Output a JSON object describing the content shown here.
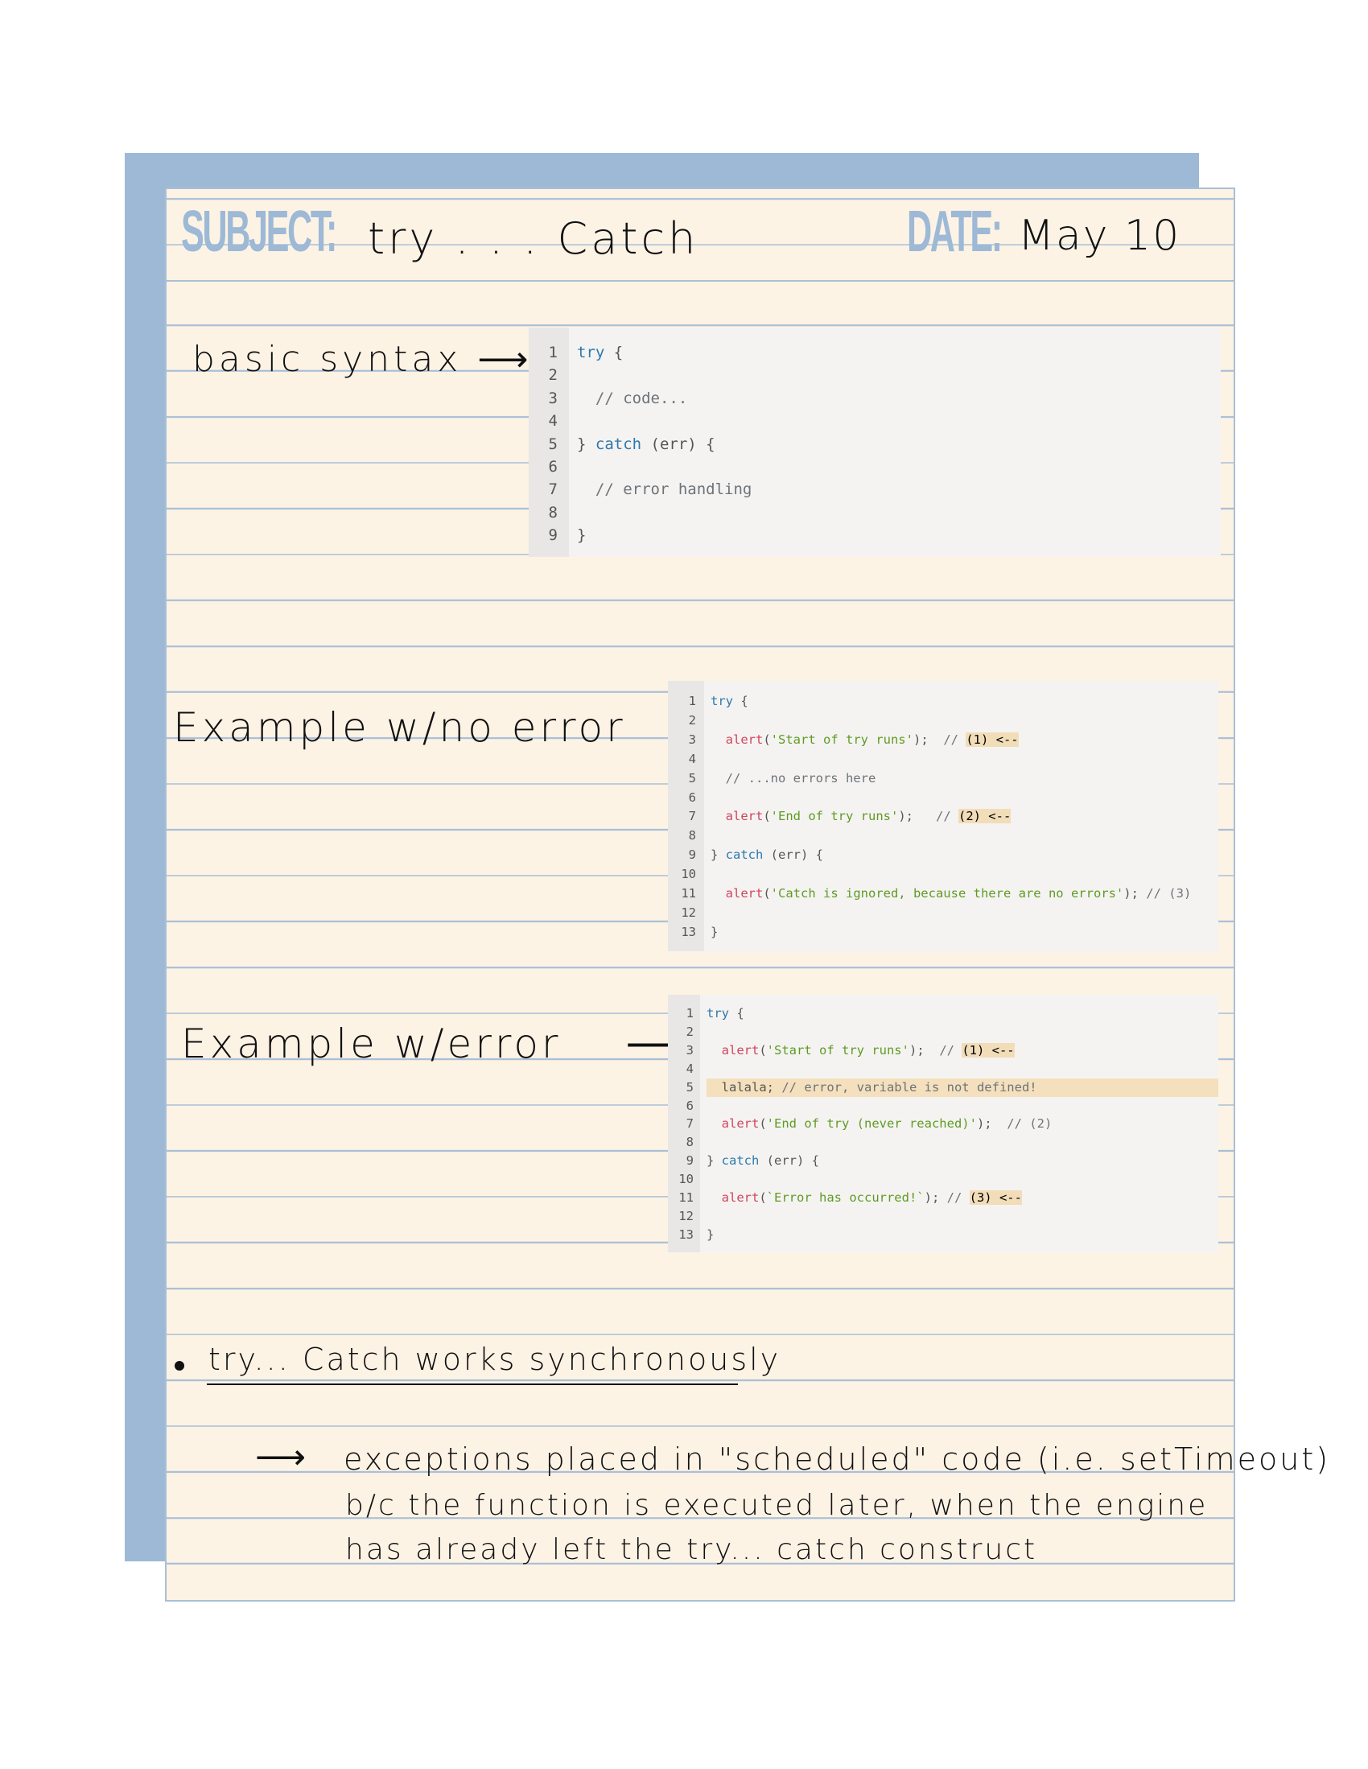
{
  "header": {
    "subject_label": "SUBJECT:",
    "subject_value": "try . . . Catch",
    "date_label": "DATE:",
    "date_value": "May 10"
  },
  "sections": {
    "basic": {
      "label": "basic syntax",
      "arrow": "⟶"
    },
    "no_error": {
      "label": "Example w/no error",
      "arrow": "⟶"
    },
    "with_error": {
      "label": "Example w/error",
      "arrow": "⟶"
    }
  },
  "code_basic": [
    {
      "n": "1",
      "parts": [
        [
          "kw",
          "try"
        ],
        [
          "pn",
          " {"
        ]
      ]
    },
    {
      "n": "2",
      "parts": []
    },
    {
      "n": "3",
      "parts": [
        [
          "cm",
          "  // code..."
        ]
      ]
    },
    {
      "n": "4",
      "parts": []
    },
    {
      "n": "5",
      "parts": [
        [
          "pn",
          "} "
        ],
        [
          "kw",
          "catch"
        ],
        [
          "pn",
          " (err) {"
        ]
      ]
    },
    {
      "n": "6",
      "parts": []
    },
    {
      "n": "7",
      "parts": [
        [
          "cm",
          "  // error handling"
        ]
      ]
    },
    {
      "n": "8",
      "parts": []
    },
    {
      "n": "9",
      "parts": [
        [
          "pn",
          "}"
        ]
      ]
    }
  ],
  "code_no_error": [
    {
      "n": "1",
      "parts": [
        [
          "kw",
          "try"
        ],
        [
          "pn",
          " {"
        ]
      ]
    },
    {
      "n": "2",
      "parts": []
    },
    {
      "n": "3",
      "parts": [
        [
          "fn",
          "  alert"
        ],
        [
          "pn",
          "("
        ],
        [
          "str",
          "'Start of try runs'"
        ],
        [
          "pn",
          ");  "
        ],
        [
          "cm",
          "// "
        ],
        [
          "hl",
          "(1) <--"
        ]
      ]
    },
    {
      "n": "4",
      "parts": []
    },
    {
      "n": "5",
      "parts": [
        [
          "cm",
          "  // ...no errors here"
        ]
      ]
    },
    {
      "n": "6",
      "parts": []
    },
    {
      "n": "7",
      "parts": [
        [
          "fn",
          "  alert"
        ],
        [
          "pn",
          "("
        ],
        [
          "str",
          "'End of try runs'"
        ],
        [
          "pn",
          ");   "
        ],
        [
          "cm",
          "// "
        ],
        [
          "hl",
          "(2) <--"
        ]
      ]
    },
    {
      "n": "8",
      "parts": []
    },
    {
      "n": "9",
      "parts": [
        [
          "pn",
          "} "
        ],
        [
          "kw",
          "catch"
        ],
        [
          "pn",
          " (err) {"
        ]
      ]
    },
    {
      "n": "10",
      "parts": []
    },
    {
      "n": "11",
      "parts": [
        [
          "fn",
          "  alert"
        ],
        [
          "pn",
          "("
        ],
        [
          "str",
          "'Catch is ignored, because there are no errors'"
        ],
        [
          "pn",
          "); "
        ],
        [
          "cm",
          "// (3)"
        ]
      ]
    },
    {
      "n": "12",
      "parts": []
    },
    {
      "n": "13",
      "parts": [
        [
          "pn",
          "}"
        ]
      ]
    }
  ],
  "code_with_error": [
    {
      "n": "1",
      "parts": [
        [
          "kw",
          "try"
        ],
        [
          "pn",
          " {"
        ]
      ]
    },
    {
      "n": "2",
      "parts": []
    },
    {
      "n": "3",
      "parts": [
        [
          "fn",
          "  alert"
        ],
        [
          "pn",
          "("
        ],
        [
          "str",
          "'Start of try runs'"
        ],
        [
          "pn",
          ");  "
        ],
        [
          "cm",
          "// "
        ],
        [
          "hl",
          "(1) <--"
        ]
      ]
    },
    {
      "n": "4",
      "parts": []
    },
    {
      "n": "5",
      "row_hl": true,
      "parts": [
        [
          "pn",
          "  lalala; "
        ],
        [
          "cm",
          "// error, variable is not defined!"
        ]
      ]
    },
    {
      "n": "6",
      "parts": []
    },
    {
      "n": "7",
      "parts": [
        [
          "fn",
          "  alert"
        ],
        [
          "pn",
          "("
        ],
        [
          "str",
          "'End of try (never reached)'"
        ],
        [
          "pn",
          ");  "
        ],
        [
          "cm",
          "// (2)"
        ]
      ]
    },
    {
      "n": "8",
      "parts": []
    },
    {
      "n": "9",
      "parts": [
        [
          "pn",
          "} "
        ],
        [
          "kw",
          "catch"
        ],
        [
          "pn",
          " (err) {"
        ]
      ]
    },
    {
      "n": "10",
      "parts": []
    },
    {
      "n": "11",
      "parts": [
        [
          "fn",
          "  alert"
        ],
        [
          "pn",
          "("
        ],
        [
          "str",
          "`Error has occurred!`"
        ],
        [
          "pn",
          "); "
        ],
        [
          "cm",
          "// "
        ],
        [
          "hl",
          "(3) <--"
        ]
      ]
    },
    {
      "n": "12",
      "parts": []
    },
    {
      "n": "13",
      "parts": [
        [
          "pn",
          "}"
        ]
      ]
    }
  ],
  "notes": {
    "bullet_text": "try... Catch works synchronously",
    "arrow": "⟶",
    "line1": "exceptions placed in \"scheduled\" code (i.e. setTimeout)",
    "line2": "b/c the function is executed later, when the engine",
    "line3": "has already left the try... catch construct"
  },
  "colors": {
    "paper": "#fdf3e5",
    "back_sheet": "#9db9d6",
    "rule": "#a9bfd6",
    "header_label": "#9db9d6"
  }
}
